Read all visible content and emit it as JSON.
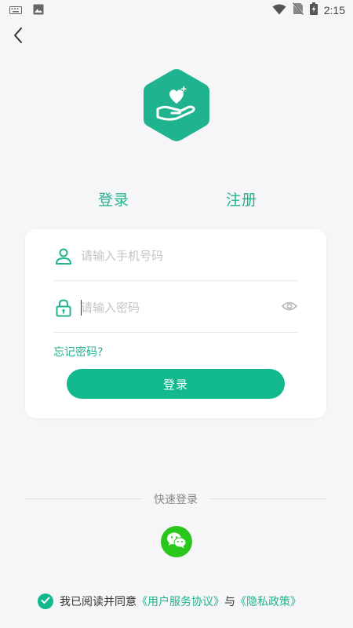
{
  "status_bar": {
    "time": "2:15",
    "icons": [
      "keyboard-icon",
      "image-icon",
      "wifi-icon",
      "no-sim-icon",
      "battery-charging-icon"
    ]
  },
  "navigation": {
    "back_icon": "chevron-left-icon"
  },
  "logo": {
    "icon": "heart-in-hand-icon",
    "color": "#1fb48f"
  },
  "tabs": [
    {
      "label": "登录",
      "active": true
    },
    {
      "label": "注册",
      "active": false
    }
  ],
  "login_form": {
    "phone_placeholder": "请输入手机号码",
    "password_placeholder": "请输入密码",
    "forgot_password": "忘记密码?",
    "submit_label": "登录"
  },
  "quick_login": {
    "label": "快速登录",
    "provider_icon": "wechat-icon"
  },
  "agreement": {
    "prefix": "我已阅读并同意",
    "terms": "《用户服务协议》",
    "conjunction": "与",
    "privacy": "《隐私政策》",
    "checked": true
  },
  "colors": {
    "accent": "#13b98e",
    "accent_text": "#1fb48f",
    "background": "#f6f5f8",
    "wechat": "#29c71c"
  }
}
